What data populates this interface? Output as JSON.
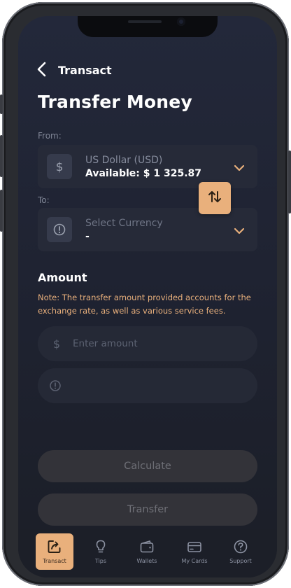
{
  "header": {
    "back_icon": "chevron-left-icon",
    "title": "Transact"
  },
  "page_title": "Transfer Money",
  "from": {
    "label": "From:",
    "icon": "dollar-icon",
    "currency": "US Dollar (USD)",
    "available": "Available: $ 1 325.87"
  },
  "swap": {
    "icon": "swap-arrows-icon"
  },
  "to": {
    "label": "To:",
    "icon": "info-icon",
    "placeholder": "Select Currency",
    "value": "-"
  },
  "amount": {
    "title": "Amount",
    "note": "Note: The transfer amount provided accounts for the exchange rate, as well as various service fees.",
    "currency_symbol": "$",
    "placeholder": "Enter amount",
    "value": "",
    "result_value": ""
  },
  "buttons": {
    "calculate": "Calculate",
    "transfer": "Transfer"
  },
  "nav": {
    "active": "Transact",
    "items": [
      {
        "label": "Transact",
        "icon": "transact-icon"
      },
      {
        "label": "Tips",
        "icon": "lightbulb-icon"
      },
      {
        "label": "Wallets",
        "icon": "wallet-icon"
      },
      {
        "label": "My Cards",
        "icon": "card-icon"
      },
      {
        "label": "Support",
        "icon": "help-icon"
      }
    ]
  },
  "colors": {
    "accent": "#e9b07c",
    "background": "#1f2332",
    "card": "#262a38",
    "button_disabled": "#333339"
  }
}
